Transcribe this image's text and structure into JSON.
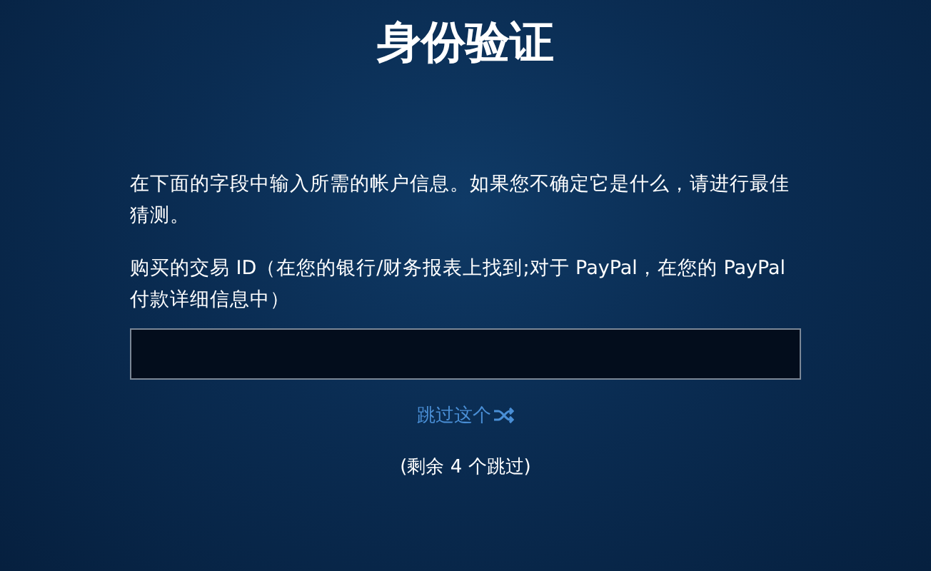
{
  "title": "身份验证",
  "instructions": "在下面的字段中输入所需的帐户信息。如果您不确定它是什么，请进行最佳猜测。",
  "field": {
    "label": "购买的交易 ID（在您的银行/财务报表上找到;对于 PayPal，在您的 PayPal 付款详细信息中）"
  },
  "skip_link": "跳过这个",
  "skips_remaining": "(剩余 4 个跳过)"
}
